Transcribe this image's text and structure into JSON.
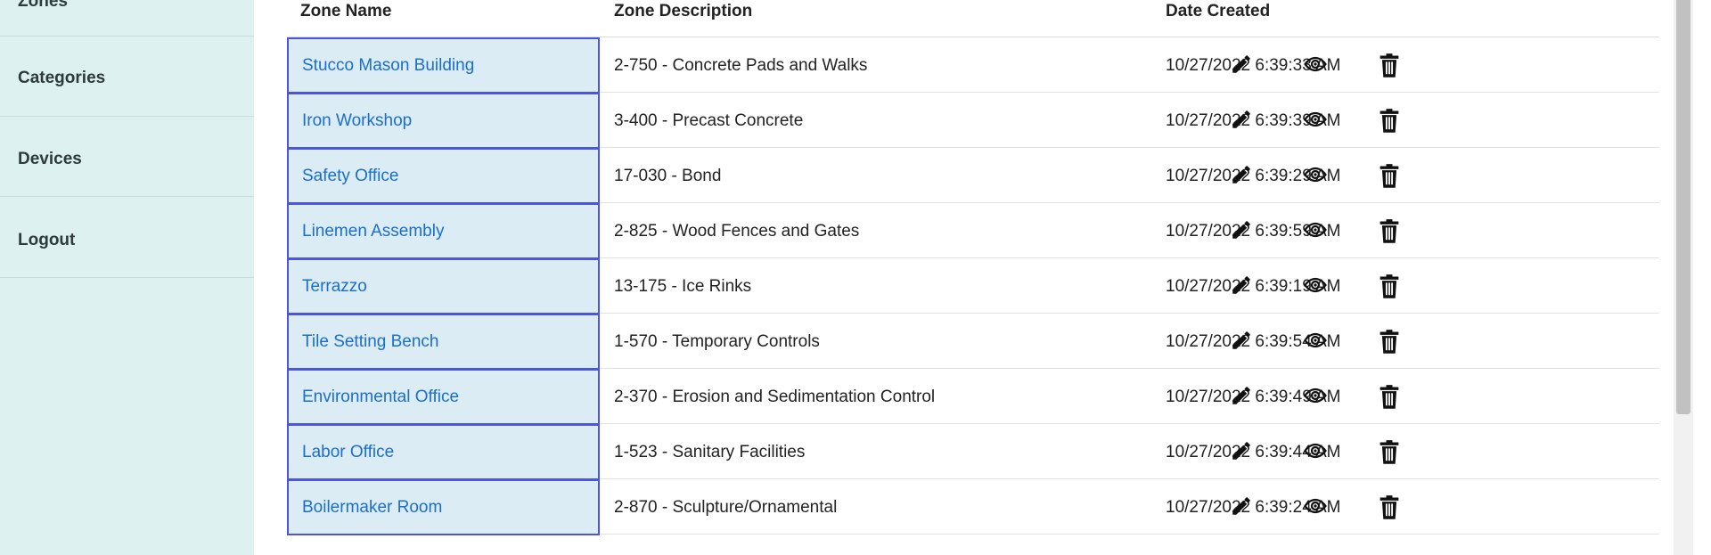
{
  "sidebar": {
    "items": [
      {
        "label": "Zones"
      },
      {
        "label": "Categories"
      },
      {
        "label": "Devices"
      },
      {
        "label": "Logout"
      }
    ]
  },
  "table": {
    "headers": {
      "zone_name": "Zone Name",
      "zone_description": "Zone Description",
      "date_created": "Date Created"
    },
    "rows": [
      {
        "name": "Stucco Mason Building",
        "description": "2-750 - Concrete Pads and Walks",
        "date": "10/27/2022 6:39:33 AM"
      },
      {
        "name": "Iron Workshop",
        "description": "3-400 - Precast Concrete",
        "date": "10/27/2022 6:39:39 AM"
      },
      {
        "name": "Safety Office",
        "description": "17-030 - Bond",
        "date": "10/27/2022 6:39:29 AM"
      },
      {
        "name": "Linemen Assembly",
        "description": "2-825 - Wood Fences and Gates",
        "date": "10/27/2022 6:39:59 AM"
      },
      {
        "name": "Terrazzo",
        "description": "13-175 - Ice Rinks",
        "date": "10/27/2022 6:39:19 AM"
      },
      {
        "name": "Tile Setting Bench",
        "description": "1-570 - Temporary Controls",
        "date": "10/27/2022 6:39:54 AM"
      },
      {
        "name": "Environmental Office",
        "description": "2-370 - Erosion and Sedimentation Control",
        "date": "10/27/2022 6:39:49 AM"
      },
      {
        "name": "Labor Office",
        "description": "1-523 - Sanitary Facilities",
        "date": "10/27/2022 6:39:44 AM"
      },
      {
        "name": "Boilermaker Room",
        "description": "2-870 - Sculpture/Ornamental",
        "date": "10/27/2022 6:39:24 AM"
      }
    ],
    "actions": [
      "pencil-icon",
      "eye-icon",
      "trash-icon"
    ]
  },
  "colors": {
    "sidebar_bg": "#dcf1f0",
    "link": "#1a6fcc",
    "name_cell_bg": "#dcecf4",
    "name_cell_border": "#4b55e0"
  }
}
